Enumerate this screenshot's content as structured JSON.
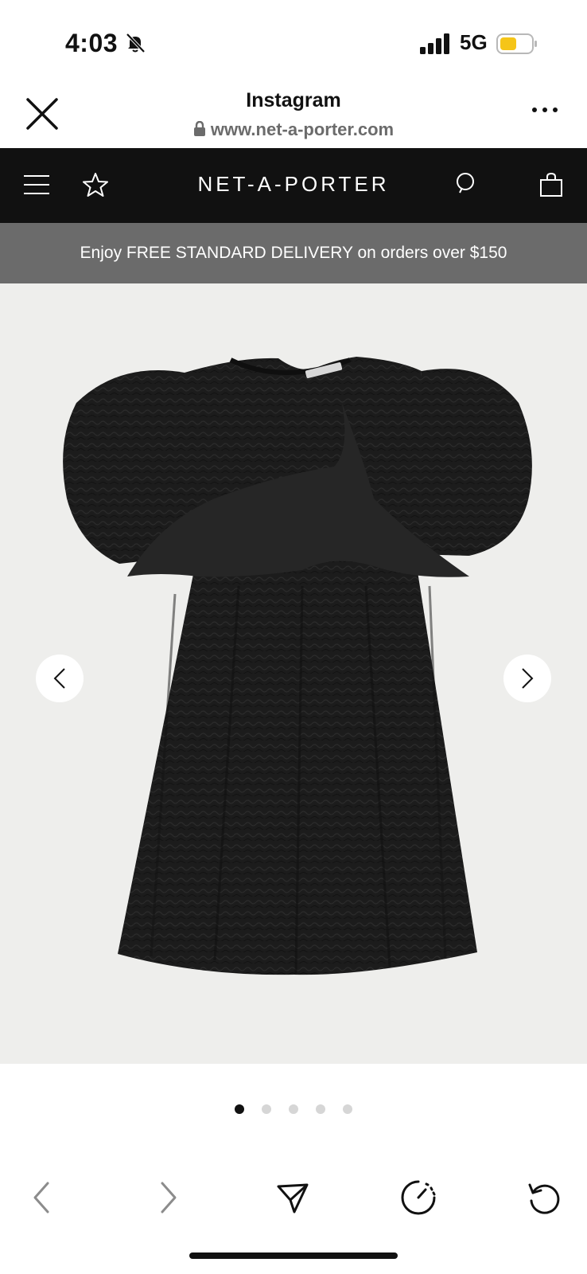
{
  "status_bar": {
    "time": "4:03",
    "network": "5G",
    "battery_color": "#f5c518"
  },
  "browser": {
    "title": "Instagram",
    "url": "www.net-a-porter.com"
  },
  "site": {
    "logo": "NET-A-PORTER",
    "promo": "Enjoy FREE STANDARD DELIVERY on orders over $150"
  },
  "gallery": {
    "product_image": "black-puff-sleeve-dress",
    "slide_count": 5,
    "active_slide": 1
  },
  "toolbar": {
    "icons": [
      "back-icon",
      "forward-icon",
      "share-icon",
      "speed-icon",
      "reload-icon"
    ]
  },
  "colors": {
    "nav_bg": "#111111",
    "promo_bg": "#6b6b6b",
    "gallery_bg": "#eeeeec"
  }
}
